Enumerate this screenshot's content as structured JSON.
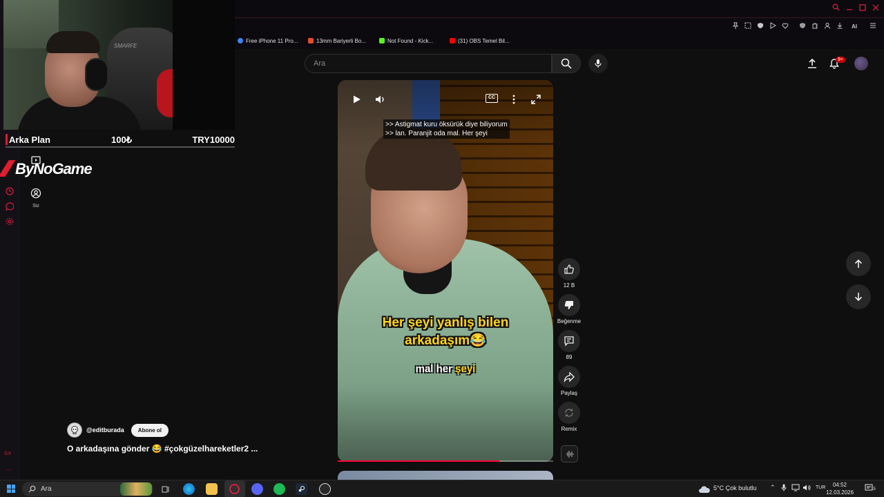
{
  "browser": {
    "bookmarks": [
      {
        "label": "Free iPhone 11 Pro...",
        "color": "#3b82f6"
      },
      {
        "label": "13mm Bariyerli Bo...",
        "color": "#e34b2f"
      },
      {
        "label": "Not Found - Kick...",
        "color": "#53fc18"
      },
      {
        "label": "(31) OBS Temel Bil...",
        "color": "#ff0000"
      }
    ],
    "toolbar_ai_label": "AI"
  },
  "youtube": {
    "search": {
      "placeholder": "Ara"
    },
    "notifications_badge": "9+",
    "rail": {
      "you_label": "Siz"
    },
    "short": {
      "captions": [
        ">> Astigmat kuru öksürük diye biliyorum",
        ">> lan. Paranjit oda mal. Her şeyi"
      ],
      "overlay_line1": "Her şeyi yanlış bilen",
      "overlay_line2": "arkadaşım😂",
      "overlay_sub_a": "mal her ",
      "overlay_sub_b": "şeyi",
      "progress": 0.75
    },
    "actions": {
      "like_count": "12 B",
      "dislike_label": "Beğenme",
      "comment_count": "89",
      "share_label": "Paylaş",
      "remix_label": "Remix"
    },
    "channel": {
      "handle": "@editburada",
      "subscribe_label": "Abone ol",
      "title": "O arkadaşına gönder 😂 #çokgüzelhareketler2 ..."
    }
  },
  "stream_overlay": {
    "donation": {
      "label": "Arka Plan",
      "amount": "100₺",
      "goal": "TRY10000"
    },
    "brand": "ByNoGame",
    "chair_logo": "SMARFE"
  },
  "opera_sidebar": {
    "gx_label": "GX",
    "more_label": "..."
  },
  "taskbar": {
    "search_label": "Ara",
    "weather": "5°C  Çok bulutlu",
    "lang": "TUR",
    "time": "04:52",
    "date": "12.03.2026",
    "notif_count": "15"
  },
  "colors": {
    "accent": "#ff0033",
    "opera_red": "#d3213f",
    "overlay_yellow": "#ffd41e"
  }
}
